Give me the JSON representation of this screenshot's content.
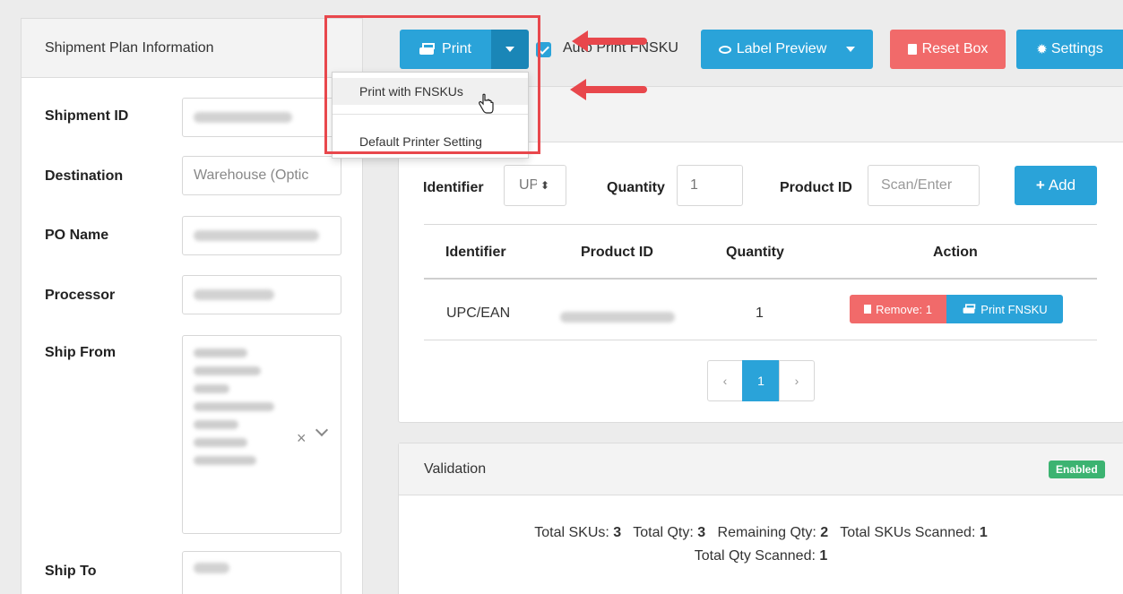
{
  "left_panel": {
    "title": "Shipment Plan Information",
    "fields": [
      {
        "label": "Shipment ID",
        "value": ""
      },
      {
        "label": "Destination",
        "value": "Warehouse (Optic"
      },
      {
        "label": "PO Name",
        "value": ""
      },
      {
        "label": "Processor",
        "value": ""
      },
      {
        "label": "Ship From",
        "value": ""
      },
      {
        "label": "Ship To",
        "value": ""
      }
    ]
  },
  "toolbar": {
    "print_label": "Print",
    "auto_print_label": "Auto Print FNSKU",
    "auto_print_checked": true,
    "label_preview_label": "Label Preview",
    "reset_box_label": "Reset Box",
    "settings_label": "Settings"
  },
  "print_menu": {
    "items": [
      "Print with FNSKUs",
      "Default Printer Setting"
    ]
  },
  "scan_form": {
    "identifier_label": "Identifier",
    "identifier_value": "UPC",
    "quantity_label": "Quantity",
    "quantity_value": "1",
    "product_id_label": "Product ID",
    "product_id_placeholder": "Scan/Enter",
    "add_label": "Add"
  },
  "items_table": {
    "headers": [
      "Identifier",
      "Product ID",
      "Quantity",
      "Action"
    ],
    "rows": [
      {
        "identifier": "UPC/EAN",
        "product_id": "",
        "quantity": "1",
        "remove_label": "Remove: 1",
        "print_label": "Print FNSKU"
      }
    ]
  },
  "pagination": {
    "prev": "‹",
    "current": "1",
    "next": "›"
  },
  "validation": {
    "title": "Validation",
    "badge": "Enabled",
    "line1": {
      "total_skus_label": "Total SKUs:",
      "total_skus": "3",
      "total_qty_label": "Total Qty:",
      "total_qty": "3",
      "remaining_label": "Remaining Qty:",
      "remaining": "2",
      "scanned_skus_label": "Total SKUs Scanned:",
      "scanned_skus": "1"
    },
    "line2": {
      "scanned_qty_label": "Total Qty Scanned:",
      "scanned_qty": "1"
    }
  },
  "colors": {
    "accent": "#2aa3d9",
    "danger": "#f16a6a",
    "success": "#3cb371",
    "annotation": "#e8474c"
  }
}
